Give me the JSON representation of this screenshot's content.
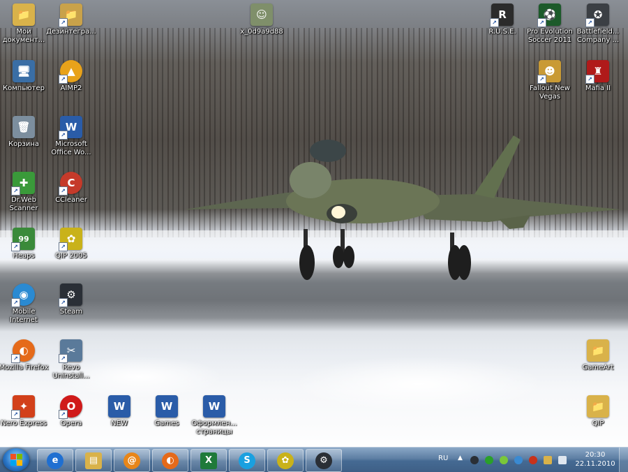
{
  "desktop_icons": [
    {
      "id": "my-documents",
      "label": "Мои документ...",
      "glyph": "📁",
      "color": "#d9b24a"
    },
    {
      "id": "disintegration",
      "label": "Дезинтегра...",
      "glyph": "📁",
      "color": "#c9a24a"
    },
    {
      "id": "x-user",
      "label": "x_0d9a9d88",
      "glyph": "☺",
      "color": "#7f8f6a"
    },
    {
      "id": "ruse",
      "label": "R.U.S.E.",
      "glyph": "R",
      "color": "#2b2b2b"
    },
    {
      "id": "pes2011",
      "label": "Pro Evolution Soccer 2011",
      "glyph": "⚽",
      "color": "#1c5a2a"
    },
    {
      "id": "battlefield",
      "label": "Battlefield... Company ...",
      "glyph": "✪",
      "color": "#3b3f44"
    },
    {
      "id": "computer",
      "label": "Компьютер",
      "glyph": "🖥",
      "color": "#3a6ea5"
    },
    {
      "id": "aimp2",
      "label": "AIMP2",
      "glyph": "▲",
      "color": "#e8a21a"
    },
    {
      "id": "fallout",
      "label": "Fallout New Vegas",
      "glyph": "☻",
      "color": "#c99a35"
    },
    {
      "id": "mafia2",
      "label": "Mafia II",
      "glyph": "♜",
      "color": "#b01a1a"
    },
    {
      "id": "recycle",
      "label": "Корзина",
      "glyph": "🗑",
      "color": "#7c8e9e"
    },
    {
      "id": "msword",
      "label": "Microsoft Office Wo...",
      "glyph": "W",
      "color": "#2a5ca8"
    },
    {
      "id": "drweb",
      "label": "Dr.Web Scanner",
      "glyph": "✚",
      "color": "#3a9a3a"
    },
    {
      "id": "ccleaner",
      "label": "CCleaner",
      "glyph": "C",
      "color": "#c53a2a"
    },
    {
      "id": "heaps",
      "label": "Heaps",
      "glyph": "99",
      "color": "#3a8a3a"
    },
    {
      "id": "qip2005",
      "label": "QIP 2005",
      "glyph": "✿",
      "color": "#c9b21a"
    },
    {
      "id": "mobile-internet",
      "label": "Mobile Internet",
      "glyph": "◉",
      "color": "#2a8ad2"
    },
    {
      "id": "steam",
      "label": "Steam",
      "glyph": "⚙",
      "color": "#2a2f36"
    },
    {
      "id": "firefox",
      "label": "Mozilla Firefox",
      "glyph": "◐",
      "color": "#e56a1a"
    },
    {
      "id": "revo",
      "label": "Revo Uninstall...",
      "glyph": "✂",
      "color": "#5a7a9a"
    },
    {
      "id": "gameart",
      "label": "GameArt",
      "glyph": "📁",
      "color": "#d9b24a"
    },
    {
      "id": "nero",
      "label": "Nero Express",
      "glyph": "✦",
      "color": "#d2401a"
    },
    {
      "id": "opera",
      "label": "Opera",
      "glyph": "O",
      "color": "#d01a1a"
    },
    {
      "id": "new-doc",
      "label": "NEW",
      "glyph": "W",
      "color": "#2a5ca8"
    },
    {
      "id": "games-doc",
      "label": "Games",
      "glyph": "W",
      "color": "#2a5ca8"
    },
    {
      "id": "formatting-doc",
      "label": "Оформлен... страницы",
      "glyph": "W",
      "color": "#2a5ca8"
    },
    {
      "id": "qip-folder",
      "label": "QIP",
      "glyph": "📁",
      "color": "#d9b24a"
    }
  ],
  "taskbar": {
    "pinned": [
      {
        "id": "internet-explorer",
        "glyph": "e",
        "color": "#1f6fd1"
      },
      {
        "id": "explorer",
        "glyph": "▤",
        "color": "#d9b24a"
      },
      {
        "id": "qip-at",
        "glyph": "@",
        "color": "#e8861a"
      },
      {
        "id": "firefox",
        "glyph": "◐",
        "color": "#e56a1a"
      },
      {
        "id": "excel",
        "glyph": "X",
        "color": "#1f7a3a"
      },
      {
        "id": "skype",
        "glyph": "S",
        "color": "#1aa0e0"
      },
      {
        "id": "qip",
        "glyph": "✿",
        "color": "#c9b21a"
      },
      {
        "id": "steam",
        "glyph": "⚙",
        "color": "#2a2f36"
      }
    ],
    "tray": {
      "language": "RU",
      "show_hidden": "▲",
      "icons": [
        {
          "id": "steam-tray",
          "color": "#2a2f36"
        },
        {
          "id": "icq-tray",
          "color": "#2aa02a"
        },
        {
          "id": "qip-tray",
          "color": "#7ac83a"
        },
        {
          "id": "network-tray",
          "color": "#3a8ad2"
        },
        {
          "id": "antivirus-tray",
          "color": "#c8321a"
        },
        {
          "id": "monitor-tray",
          "color": "#d9b24a"
        },
        {
          "id": "volume-tray",
          "color": "#dfe6ef"
        }
      ],
      "time": "20:30",
      "date": "22.11.2010"
    }
  }
}
